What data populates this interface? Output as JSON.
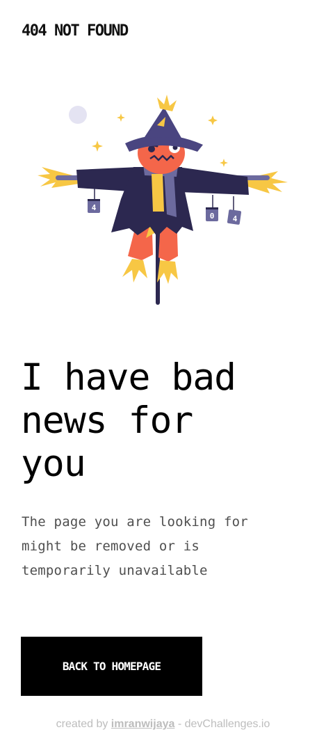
{
  "header": {
    "logo_text": "404 NOT FOUND"
  },
  "illustration": {
    "icon": "scarecrow-illustration",
    "can_labels": [
      "4",
      "0",
      "4"
    ]
  },
  "main": {
    "headline_line1": "I have bad",
    "headline_line2": "news for",
    "headline_line3": "you",
    "description_line1": "The page you are looking for",
    "description_line2": "might be removed or is",
    "description_line3": "temporarily unavailable",
    "button_label": "BACK TO HOMEPAGE"
  },
  "footer": {
    "prefix": "created by ",
    "author": "imranwijaya",
    "suffix": " - devChallenges.io"
  },
  "colors": {
    "hat": "#4a4580",
    "coat": "#2c2850",
    "face": "#f4664a",
    "straw": "#f7c744",
    "button": "#000000"
  }
}
